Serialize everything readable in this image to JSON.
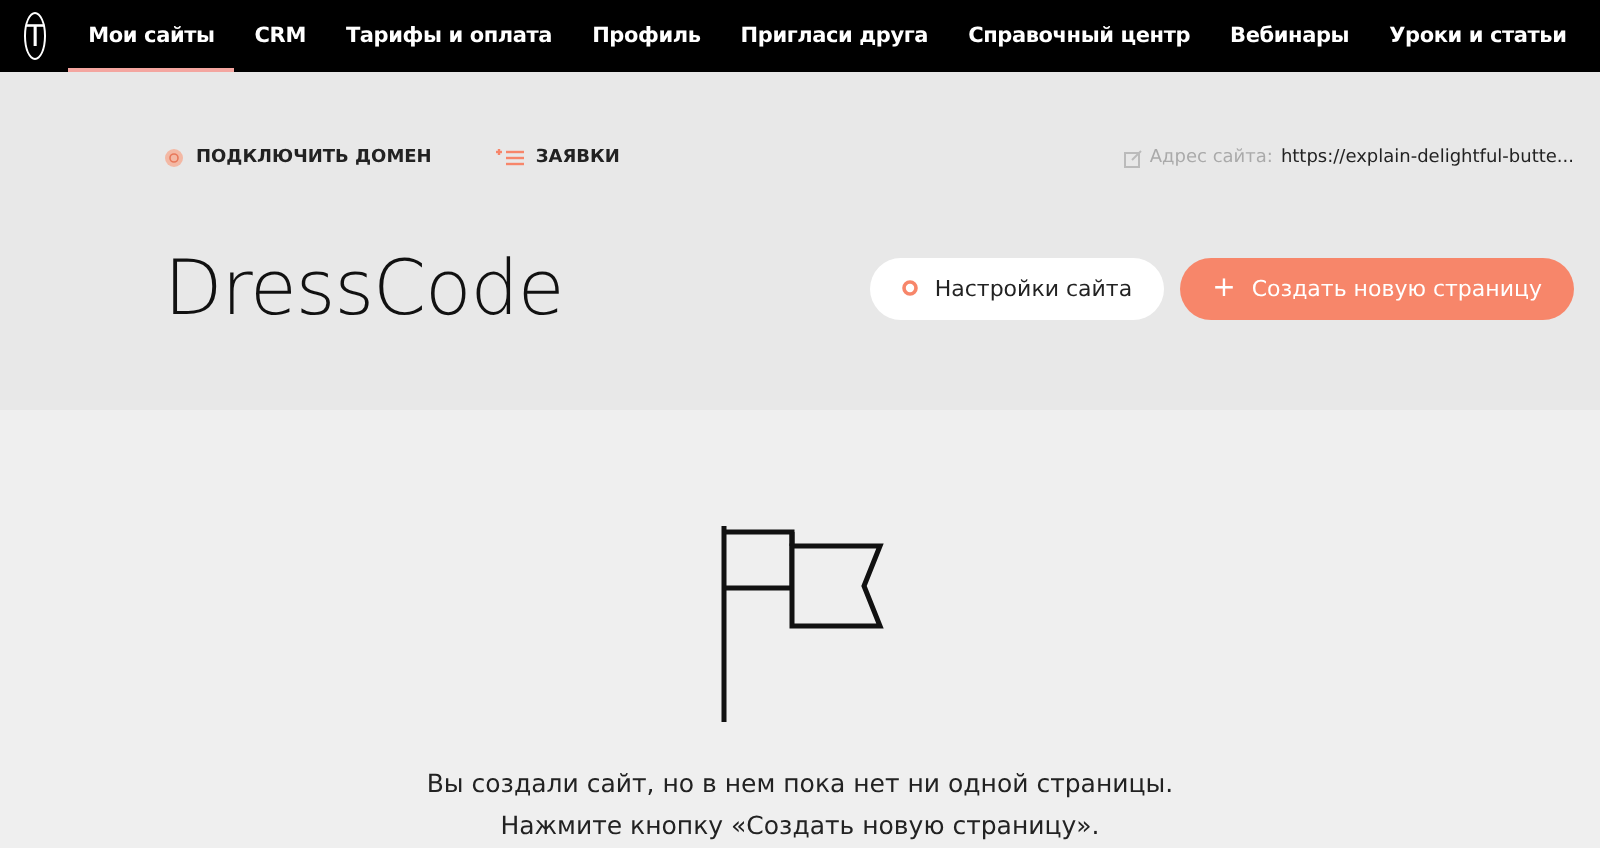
{
  "logo": "T",
  "nav": [
    {
      "label": "Мои сайты",
      "selected": true
    },
    {
      "label": "CRM",
      "selected": false
    },
    {
      "label": "Тарифы и оплата",
      "selected": false
    },
    {
      "label": "Профиль",
      "selected": false
    },
    {
      "label": "Пригласи друга",
      "selected": false
    }
  ],
  "nav_right": [
    "Справочный центр",
    "Вебинары",
    "Уроки и статьи"
  ],
  "actions": [
    {
      "kind": "globe",
      "label": "ПОДКЛЮЧИТЬ ДОМЕН"
    },
    {
      "kind": "list",
      "label": "ЗАЯВКИ"
    }
  ],
  "site_address": {
    "label": "Адрес сайта:",
    "value": "https://explain-delightful-butte..."
  },
  "site_title": "DressCode",
  "buttons": [
    {
      "kind": "secondary",
      "label": "Настройки сайта"
    },
    {
      "kind": "primary",
      "icon": "+",
      "label": "Создать новую страницу"
    }
  ],
  "empty_state": [
    "Вы создали сайт, но в нем пока нет ни одной страницы.",
    "Нажмите кнопку «Создать новую страницу»."
  ]
}
